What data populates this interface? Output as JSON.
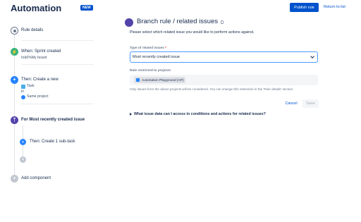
{
  "header": {
    "title": "Automation",
    "badge": "NEW",
    "publish_label": "Publish rule",
    "return_label": "Return to list"
  },
  "sidebar": {
    "rule_details": "Rule details",
    "when_title": "When: Sprint created",
    "when_sub": "Inâ€%My board",
    "then_title": "Then: Create a new",
    "then_task": "Task",
    "then_in": "in",
    "then_project": "Same project",
    "branch_title": "For Most recently created issue",
    "branch_then": "Then: Create 1 sub-task",
    "add_component": "Add component"
  },
  "panel": {
    "title": "Branch rule / related issues",
    "description": "Please select which related issue you would like to perform actions against.",
    "type_label": "Type of related issues",
    "type_required": "*",
    "type_value": "Most recently created issue",
    "restrict_label": "Rule restricted to projects",
    "project_pill": "Automation Playground (AP)",
    "restrict_note": "Only issues from the above projects will be considered. You can change this restriction in the 'Rule details' section.",
    "cancel_label": "Cancel",
    "save_label": "Save",
    "faq_label": "What issue data can I access in conditions and actions for related issues?"
  },
  "colors": {
    "primary": "#0052cc",
    "branch": "#5243aa",
    "when": "#36b37e",
    "then": "#2684ff"
  }
}
